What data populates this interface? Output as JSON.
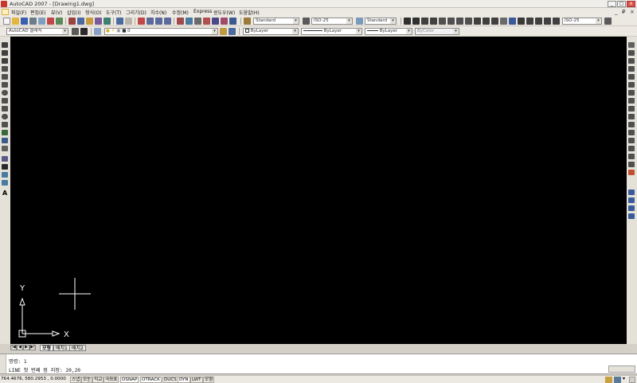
{
  "window": {
    "title": "AutoCAD 2007 - [Drawing1.dwg]",
    "minimize": "_",
    "maximize": "□",
    "close": "x"
  },
  "menubar": {
    "items": [
      "파일(F)",
      "편집(E)",
      "뷰(V)",
      "삽입(I)",
      "형식(O)",
      "도구(T)",
      "그리기(D)",
      "치수(N)",
      "수정(M)",
      "Express",
      "윈도우(W)",
      "도움말(H)"
    ],
    "doc_controls": [
      "_",
      "₽",
      "×"
    ]
  },
  "toolbars": {
    "text_style": "Standard",
    "dim_style": "ISO-25",
    "table_style": "Standard",
    "mleader_style": "ISO-25",
    "workspace": "AutoCAD 클래식",
    "layer": "0",
    "color": "ByLayer",
    "linetype": "ByLayer",
    "lineweight": "ByLayer",
    "plotstyle": "ByColor"
  },
  "ucs": {
    "y_label": "Y",
    "x_label": "X"
  },
  "tabs": {
    "nav": [
      "|◀",
      "◀",
      "▶",
      "▶|"
    ],
    "items": [
      "모형",
      "배치1",
      "배치2"
    ],
    "active": 0
  },
  "command": {
    "line1": "명령: 1",
    "line2": "LINE 첫 번째 점 지정: 20,20"
  },
  "status": {
    "coords": "764.4676, 580.2953 , 0.0000",
    "toggles": [
      "스냅",
      "모눈",
      "직교",
      "극좌표",
      "OSNAP",
      "OTRACK",
      "DUCS",
      "DYN",
      "LWT",
      "모형"
    ]
  },
  "colors": {
    "canvas": "#000000",
    "chrome": "#d4d0c8",
    "toolbar": "#ece9e2"
  }
}
